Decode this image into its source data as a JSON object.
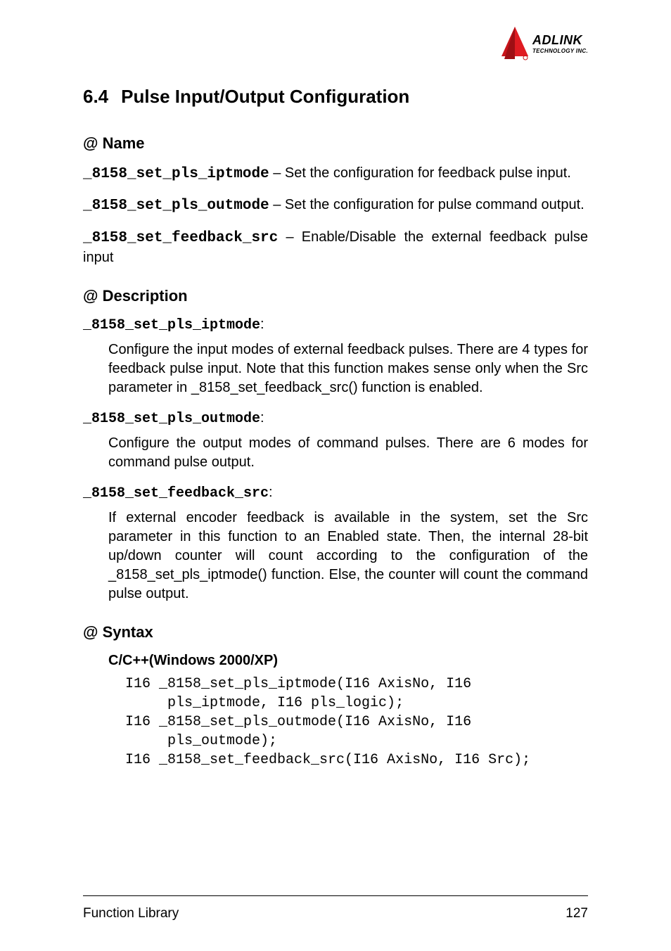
{
  "logo": {
    "brand_top": "ADLINK",
    "brand_bottom": "TECHNOLOGY INC."
  },
  "section": {
    "number": "6.4",
    "title": "Pulse Input/Output Configuration"
  },
  "name_heading": "@ Name",
  "names": [
    {
      "fn": "_8158_set_pls_iptmode",
      "desc": " – Set the configuration for feedback pulse input."
    },
    {
      "fn": "_8158_set_pls_outmode",
      "desc": " – Set the configuration for pulse command output."
    },
    {
      "fn": "_8158_set_feedback_src",
      "desc": " – Enable/Disable the external feedback pulse input"
    }
  ],
  "description_heading": "@ Description",
  "descriptions": [
    {
      "fn": "_8158_set_pls_iptmode",
      "colon": ":",
      "body": "Configure the input modes of external feedback pulses. There are 4 types for feedback pulse input. Note that this function makes sense only when the Src parameter in _8158_set_feedback_src() function is enabled."
    },
    {
      "fn": "_8158_set_pls_outmode",
      "colon": ":",
      "body": "Configure the output modes of command pulses. There are 6 modes for command pulse output."
    },
    {
      "fn": "_8158_set_feedback_src",
      "colon": ":",
      "body": "If external encoder feedback is available in the system, set the Src parameter in this function to an Enabled state. Then, the internal 28-bit up/down counter will count according to the configuration of the _8158_set_pls_iptmode() function. Else, the counter will count the command pulse output."
    }
  ],
  "syntax_heading": "@ Syntax",
  "syntax": {
    "lang": "C/C++(Windows 2000/XP)",
    "code": "I16 _8158_set_pls_iptmode(I16 AxisNo, I16\n     pls_iptmode, I16 pls_logic);\nI16 _8158_set_pls_outmode(I16 AxisNo, I16\n     pls_outmode);\nI16 _8158_set_feedback_src(I16 AxisNo, I16 Src);"
  },
  "footer": {
    "left": "Function Library",
    "right": "127"
  }
}
